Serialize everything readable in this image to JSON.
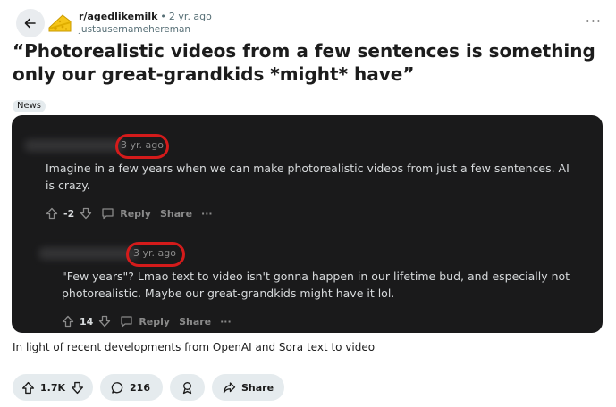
{
  "post": {
    "subreddit": "r/agedlikemilk",
    "separator": "•",
    "time_ago": "2 yr. ago",
    "author": "justausernamehereman",
    "more_label": "···",
    "title": "“Photorealistic videos from a few sentences is something only our great-grandkids *might* have”",
    "flair": "News",
    "caption": "In light of recent developments from OpenAI and Sora text to video"
  },
  "image": {
    "comments": [
      {
        "time_ago": "3 yr. ago",
        "text": "Imagine in a few years when we can make photorealistic videos from just a few sentences. AI is crazy.",
        "votes": "-2",
        "reply_label": "Reply",
        "share_label": "Share",
        "more_label": "···"
      },
      {
        "time_ago": "3 yr. ago",
        "text": "\"Few years\"? Lmao text to video isn't gonna happen in our lifetime bud, and especially not photorealistic. Maybe our great-grandkids might have it lol.",
        "votes": "14",
        "reply_label": "Reply",
        "share_label": "Share",
        "more_label": "···"
      }
    ]
  },
  "actions": {
    "upvotes": "1.7K",
    "comments": "216",
    "share_label": "Share"
  },
  "colors": {
    "dark_bg": "#1a1a1b",
    "highlight_red": "#d41b1b",
    "pill_bg": "#e5ebee"
  }
}
